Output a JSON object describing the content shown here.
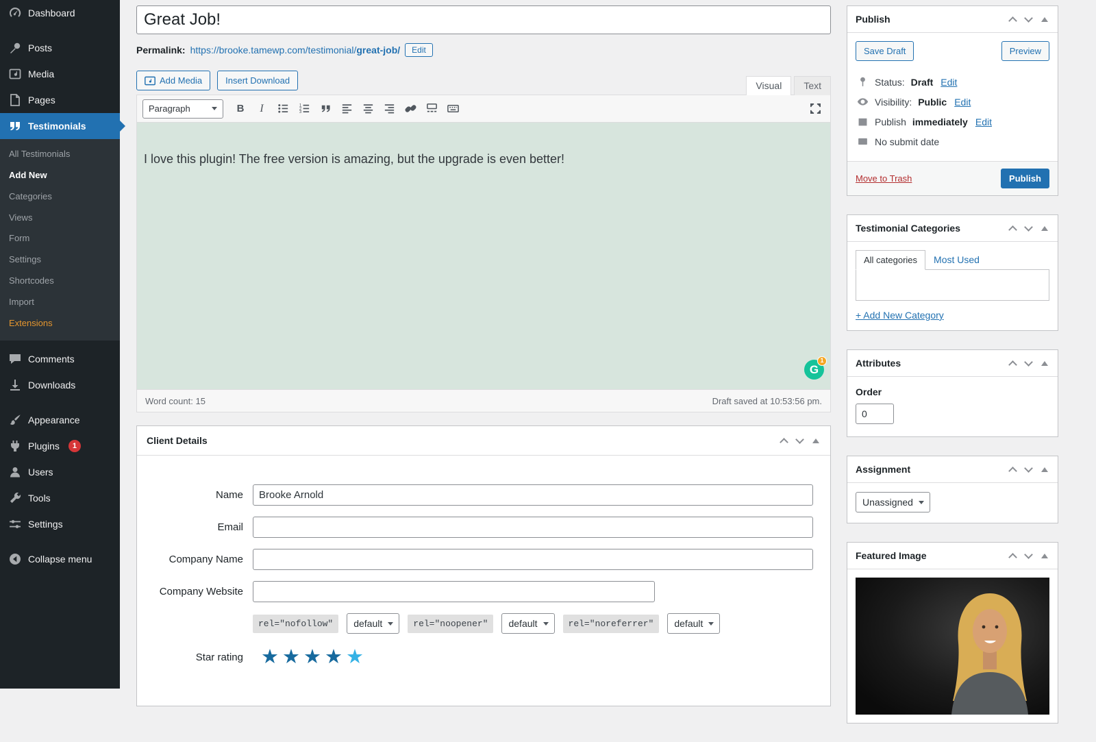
{
  "colors": {
    "accent": "#2271b1",
    "sidebar_bg": "#1d2327",
    "submenu_bg": "#2c3338",
    "active_menu": "#2271b1",
    "badge_red": "#d63638",
    "extensions_orange": "#e5962e",
    "editor_bg": "#d7e5dd",
    "star_filled": "#176a9e",
    "star_light": "#35b2e5",
    "danger_link": "#b32d2e",
    "grammarly_green": "#15c39a"
  },
  "sidebar": {
    "items": [
      "Dashboard",
      "Posts",
      "Media",
      "Pages",
      "Testimonials",
      "Comments",
      "Downloads",
      "Appearance",
      "Plugins",
      "Users",
      "Tools",
      "Settings",
      "Collapse menu"
    ],
    "plugins_badge": "1",
    "submenu": [
      "All Testimonials",
      "Add New",
      "Categories",
      "Views",
      "Form",
      "Settings",
      "Shortcodes",
      "Import",
      "Extensions"
    ]
  },
  "editor": {
    "title_value": "Great Job!",
    "permalink_label": "Permalink:",
    "permalink_base": "https://brooke.tamewp.com/testimonial/",
    "permalink_slug": "great-job/",
    "permalink_edit": "Edit",
    "add_media": "Add Media",
    "insert_download": "Insert Download",
    "tab_visual": "Visual",
    "tab_text": "Text",
    "paragraph_select": "Paragraph",
    "toolbar": {
      "bold": "B",
      "italic": "I"
    },
    "content": "I love this plugin! The free version is amazing, but the upgrade is even better!",
    "grammarly_badge": "1",
    "word_count": "Word count: 15",
    "draft_saved": "Draft saved at 10:53:56 pm."
  },
  "client_details": {
    "title": "Client Details",
    "fields": [
      {
        "label": "Name",
        "value": "Brooke Arnold"
      },
      {
        "label": "Email",
        "value": ""
      },
      {
        "label": "Company Name",
        "value": ""
      },
      {
        "label": "Company Website",
        "value": ""
      }
    ],
    "rel_options": [
      {
        "code": "rel=\"nofollow\"",
        "value": "default"
      },
      {
        "code": "rel=\"noopener\"",
        "value": "default"
      },
      {
        "code": "rel=\"noreferrer\"",
        "value": "default"
      }
    ],
    "star_label": "Star rating"
  },
  "publish_box": {
    "title": "Publish",
    "save_draft": "Save Draft",
    "preview": "Preview",
    "status_label": "Status:",
    "status_value": "Draft",
    "visibility_label": "Visibility:",
    "visibility_value": "Public",
    "publish_label": "Publish",
    "publish_value": "immediately",
    "edit": "Edit",
    "no_submit_date": "No submit date",
    "move_to_trash": "Move to Trash",
    "publish_button": "Publish"
  },
  "categories_box": {
    "title": "Testimonial Categories",
    "tab_all": "All categories",
    "tab_most_used": "Most Used",
    "add_new": "+ Add New Category"
  },
  "attributes_box": {
    "title": "Attributes",
    "order_label": "Order",
    "order_value": "0"
  },
  "assignment_box": {
    "title": "Assignment",
    "value": "Unassigned"
  },
  "featured_box": {
    "title": "Featured Image"
  }
}
